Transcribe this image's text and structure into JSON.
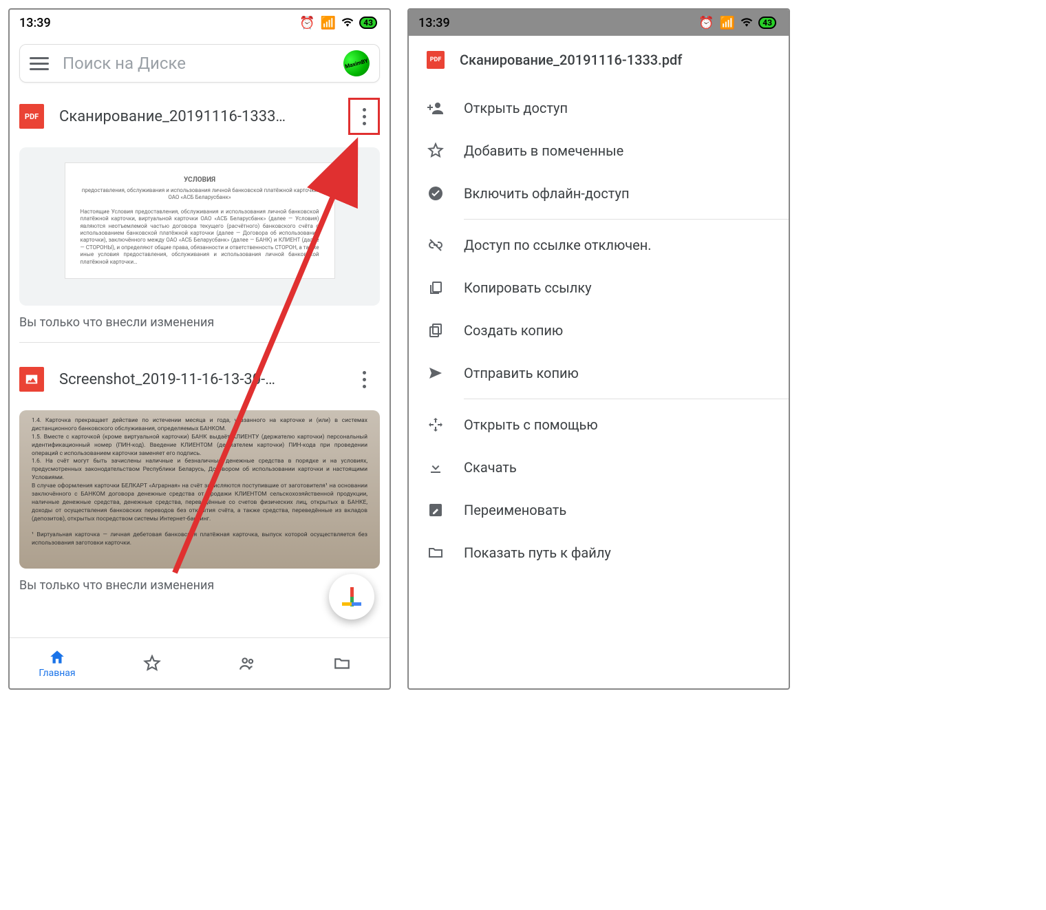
{
  "status": {
    "time": "13:39",
    "battery": "43"
  },
  "search": {
    "placeholder": "Поиск на Диске",
    "avatar_text": "MaximBY"
  },
  "files": [
    {
      "icon": "pdf",
      "title": "Сканирование_20191116-1333…",
      "caption": "Вы только что внесли изменения",
      "doc_preview": {
        "title": "УСЛОВИЯ",
        "sub": "предоставления, обслуживания и использования личной банковской платёжной карточки ОАО «АСБ Беларусбанк»",
        "body": "Настоящие Условия предоставления, обслуживания и использования личной банковской платёжной карточки, виртуальной карточки  ОАО «АСБ Беларусбанк» (далее — Условия) являются неотъемлемой частью договора текущего (расчётного) банковского счёта с использованием банковской платёжной карточки (далее — Договора об использовании карточки), заключённого между ОАО «АСБ Беларусбанк» (далее — БАНК) и КЛИЕНТ (далее — СТОРОНЫ), и определяют общие права, обязанности и ответственность СТОРОН, а также иные условия предоставления, обслуживания и использования личной банковской платёжной карточки…"
      }
    },
    {
      "icon": "image",
      "title": "Screenshot_2019-11-16-13-30-…",
      "caption": "Вы только что внесли изменения",
      "photo_text": "1.4. Карточка прекращает действие по истечении месяца и года, указанного на карточке и (или) в системах дистанционного банковского обслуживания, определяемых БАНКОМ.\n1.5. Вместе с карточкой (кроме виртуальной карточки) БАНК выдаёт КЛИЕНТУ (держателю карточки) персональный идентификационный номер (ПИН-код). Введение КЛИЕНТОМ (держателем карточки) ПИН-кода при проведении операций с использованием карточки заменяет его подпись.\n1.6. На счёт могут быть зачислены наличные и безналичные денежные средства в порядке и на условиях, предусмотренных законодательством Республики Беларусь, Договором об использовании карточки и настоящими Условиями.\nВ случае оформления карточки БЕЛКАРТ «Аграрная» на счёт зачисляются поступившие от заготовителя¹ на основании заключённого с БАНКОМ договора денежные средства от продажи КЛИЕНТОМ сельскохозяйственной продукции, наличные денежные средства, денежные средства, переведённые со счетов физических лиц, открытых в БАНКЕ, доходы от осуществления банковских переводов без открытия счёта, а также средства, переведённые из вкладов (депозитов), открытых посредством системы Интернет-банкинг.\n\n¹ Виртуальная карточка — личная дебетовая банковская платёжная карточка, выпуск которой осуществляется без использования заготовки карточки."
    }
  ],
  "nav": [
    {
      "label": "Главная",
      "icon": "home",
      "active": true
    },
    {
      "label": "",
      "icon": "star",
      "active": false
    },
    {
      "label": "",
      "icon": "people",
      "active": false
    },
    {
      "label": "",
      "icon": "folder",
      "active": false
    }
  ],
  "menu": {
    "title": "Сканирование_20191116-1333.pdf",
    "groups": [
      [
        {
          "icon": "person-add",
          "label": "Открыть доступ"
        },
        {
          "icon": "star-outline",
          "label": "Добавить в помеченные"
        },
        {
          "icon": "check-circle",
          "label": "Включить офлайн-доступ"
        }
      ],
      [
        {
          "icon": "link-off",
          "label": "Доступ по ссылке отключен."
        },
        {
          "icon": "copy-link",
          "label": "Копировать ссылку"
        },
        {
          "icon": "copy",
          "label": "Создать копию"
        },
        {
          "icon": "send",
          "label": "Отправить копию"
        }
      ],
      [
        {
          "icon": "open-with",
          "label": "Открыть с помощью"
        },
        {
          "icon": "download",
          "label": "Скачать"
        },
        {
          "icon": "edit",
          "label": "Переименовать"
        },
        {
          "icon": "folder-outline",
          "label": "Показать путь к файлу"
        }
      ]
    ]
  }
}
